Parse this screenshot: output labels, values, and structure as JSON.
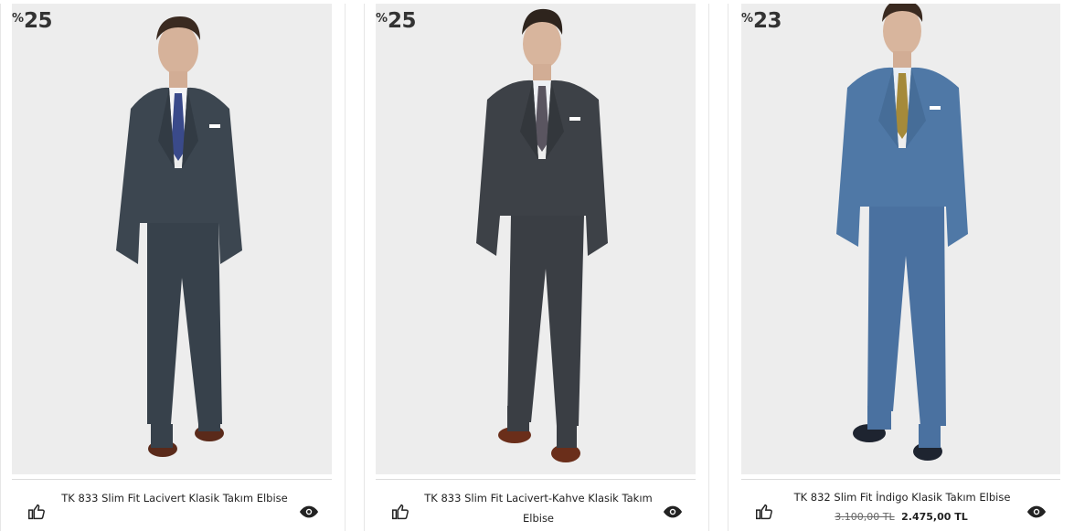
{
  "products": [
    {
      "discount_symbol": "%",
      "discount_value": "25",
      "name": "TK 833 Slim Fit Lacivert Klasik Takım Elbise",
      "suit_color": "#3c4650",
      "tie_color": "#3a4a8a",
      "like_icon": "thumbs-up-icon",
      "view_icon": "eye-icon"
    },
    {
      "discount_symbol": "%",
      "discount_value": "25",
      "name": "TK 833 Slim Fit Lacivert-Kahve Klasik Takım Elbise",
      "suit_color": "#3d4147",
      "tie_color": "#5a5560",
      "like_icon": "thumbs-up-icon",
      "view_icon": "eye-icon"
    },
    {
      "discount_symbol": "%",
      "discount_value": "23",
      "name": "TK 832 Slim Fit İndigo Klasik Takım Elbise",
      "old_price": "3.100,00 TL",
      "new_price": "2.475,00 TL",
      "suit_color": "#4f78a6",
      "tie_color": "#a58a3a",
      "like_icon": "thumbs-up-icon",
      "view_icon": "eye-icon"
    }
  ]
}
